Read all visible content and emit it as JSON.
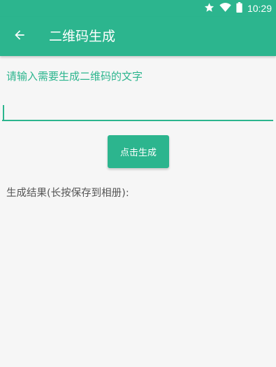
{
  "status_bar": {
    "time": "10:29",
    "icons": [
      "star-icon",
      "wifi-icon",
      "battery-icon"
    ]
  },
  "app_bar": {
    "title": "二维码生成",
    "back_icon": "arrow-left-icon"
  },
  "form": {
    "prompt_label": "请输入需要生成二维码的文字",
    "input_value": "",
    "generate_button_label": "点击生成"
  },
  "result": {
    "label": "生成结果(长按保存到相册):"
  },
  "colors": {
    "primary": "#2cb58e",
    "background": "#f6f6f6",
    "text_secondary": "#555555"
  }
}
